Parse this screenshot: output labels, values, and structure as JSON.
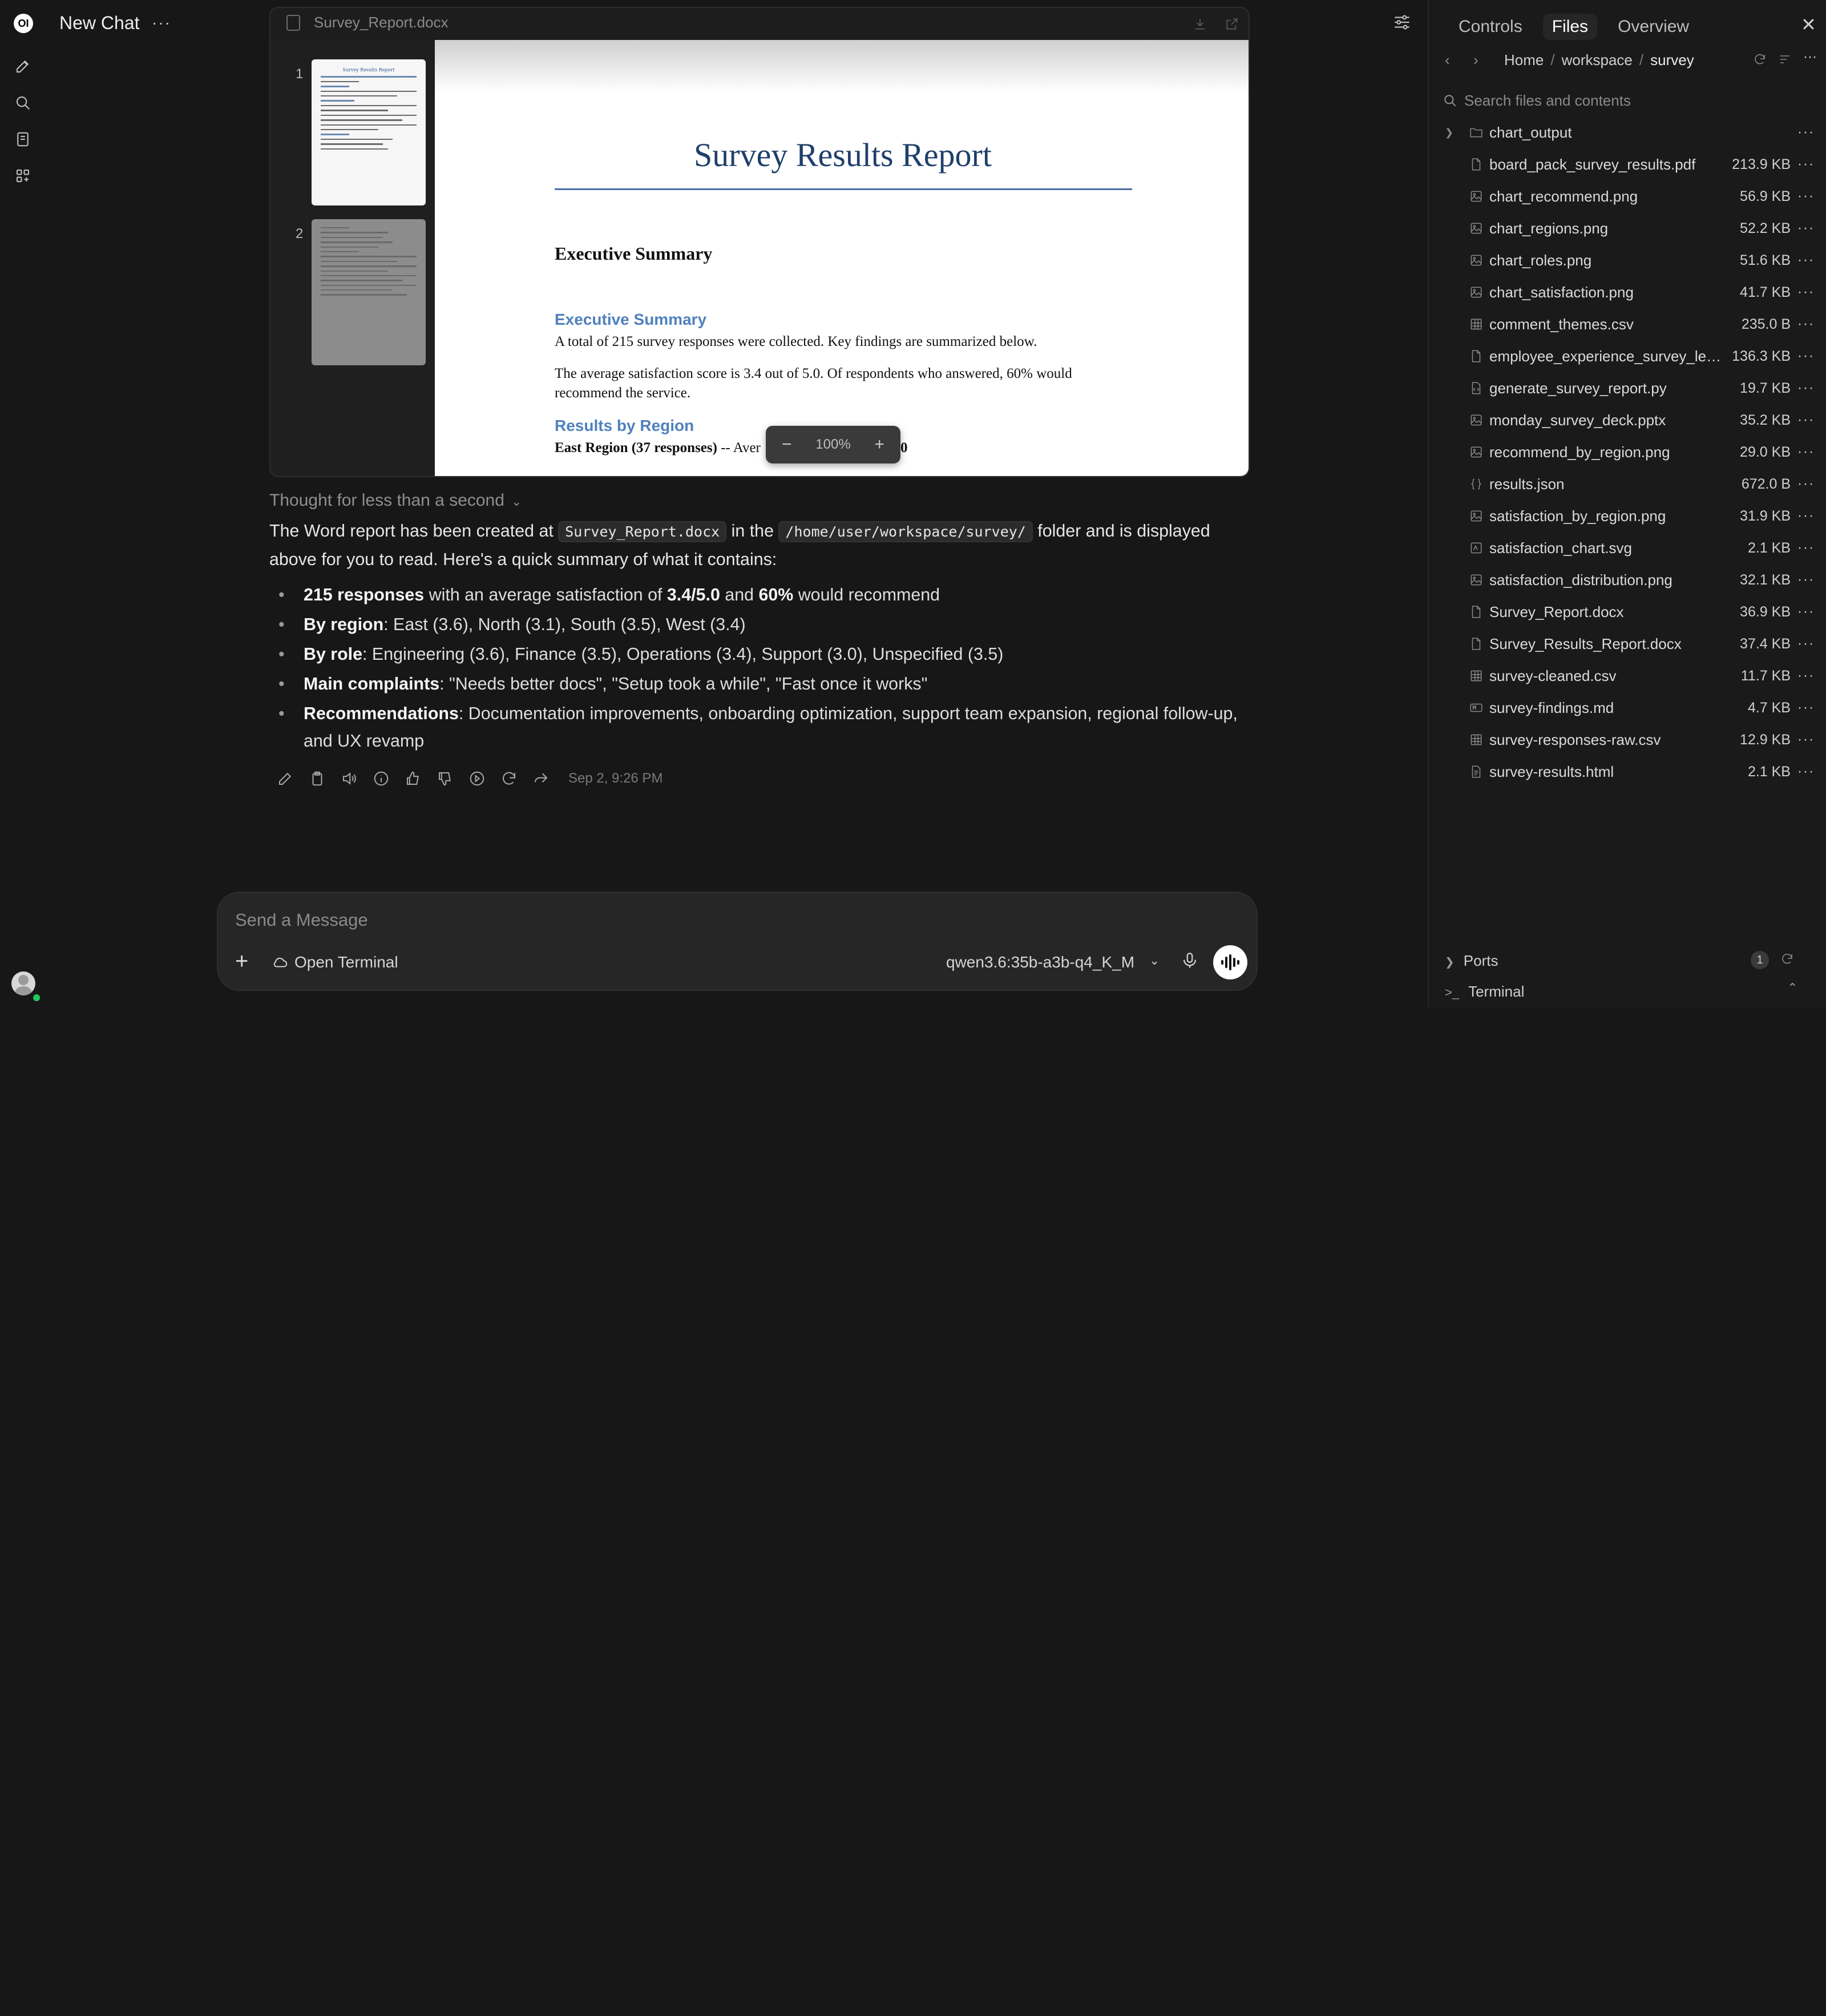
{
  "rail": {
    "logo": "OI"
  },
  "header": {
    "title": "New Chat",
    "more": "···"
  },
  "viewer": {
    "filename": "Survey_Report.docx",
    "thumbs": [
      "1",
      "2"
    ],
    "zoom": "100%",
    "zoom_minus": "−",
    "zoom_plus": "+",
    "doc": {
      "title": "Survey Results Report",
      "h1": "Executive Summary",
      "h2_exec": "Executive Summary",
      "p1": "A total of 215 survey responses were collected. Key findings are summarized below.",
      "p2": "The average satisfaction score is 3.4 out of 5.0. Of respondents who answered, 60% would recommend the service.",
      "h2_region": "Results by Region",
      "p3_bold": "East Region (37 responses)",
      "p3_rest": " -- Aver",
      "p3_tail": "0"
    }
  },
  "message": {
    "thought": "Thought for less than a second",
    "intro_1": "The Word report has been created at ",
    "intro_code1": "Survey_Report.docx",
    "intro_2": " in the ",
    "intro_code2": "/home/user/workspace/survey/",
    "intro_3": " folder and is displayed above for you to read. Here's a quick summary of what it contains:",
    "bullets": [
      {
        "bold": "215 responses",
        "text1": " with an average satisfaction of ",
        "bold2": "3.4/5.0",
        "text2": " and ",
        "bold3": "60%",
        "text3": " would recommend"
      },
      {
        "bold": "By region",
        "text": ": East (3.6), North (3.1), South (3.5), West (3.4)"
      },
      {
        "bold": "By role",
        "text": ": Engineering (3.6), Finance (3.5), Operations (3.4), Support (3.0), Unspecified (3.5)"
      },
      {
        "bold": "Main complaints",
        "text": ": \"Needs better docs\", \"Setup took a while\", \"Fast once it works\""
      },
      {
        "bold": "Recommendations",
        "text": ": Documentation improvements, onboarding optimization, support team expansion, regional follow-up, and UX revamp"
      }
    ],
    "timestamp": "Sep 2, 9:26 PM"
  },
  "composer": {
    "placeholder": "Send a Message",
    "plus": "+",
    "terminal": "Open Terminal",
    "model": "qwen3.6:35b-a3b-q4_K_M"
  },
  "panel": {
    "tabs": [
      "Controls",
      "Files",
      "Overview"
    ],
    "active_tab": "Files",
    "crumbs": [
      "Home",
      "workspace",
      "survey"
    ],
    "search_placeholder": "Search files and contents",
    "files": [
      {
        "name": "chart_output",
        "size": "",
        "icon": "folder-icon"
      },
      {
        "name": "board_pack_survey_results.pdf",
        "size": "213.9 KB",
        "icon": "file-icon"
      },
      {
        "name": "chart_recommend.png",
        "size": "56.9 KB",
        "icon": "image-icon"
      },
      {
        "name": "chart_regions.png",
        "size": "52.2 KB",
        "icon": "image-icon"
      },
      {
        "name": "chart_roles.png",
        "size": "51.6 KB",
        "icon": "image-icon"
      },
      {
        "name": "chart_satisfaction.png",
        "size": "41.7 KB",
        "icon": "image-icon"
      },
      {
        "name": "comment_themes.csv",
        "size": "235.0 B",
        "icon": "table-icon"
      },
      {
        "name": "employee_experience_survey_lead...",
        "size": "136.3 KB",
        "icon": "file-icon"
      },
      {
        "name": "generate_survey_report.py",
        "size": "19.7 KB",
        "icon": "code-icon"
      },
      {
        "name": "monday_survey_deck.pptx",
        "size": "35.2 KB",
        "icon": "image-icon"
      },
      {
        "name": "recommend_by_region.png",
        "size": "29.0 KB",
        "icon": "image-icon"
      },
      {
        "name": "results.json",
        "size": "672.0 B",
        "icon": "json-icon"
      },
      {
        "name": "satisfaction_by_region.png",
        "size": "31.9 KB",
        "icon": "image-icon"
      },
      {
        "name": "satisfaction_chart.svg",
        "size": "2.1 KB",
        "icon": "svg-icon"
      },
      {
        "name": "satisfaction_distribution.png",
        "size": "32.1 KB",
        "icon": "image-icon"
      },
      {
        "name": "Survey_Report.docx",
        "size": "36.9 KB",
        "icon": "file-icon"
      },
      {
        "name": "Survey_Results_Report.docx",
        "size": "37.4 KB",
        "icon": "file-icon"
      },
      {
        "name": "survey-cleaned.csv",
        "size": "11.7 KB",
        "icon": "table-icon"
      },
      {
        "name": "survey-findings.md",
        "size": "4.7 KB",
        "icon": "markdown-icon"
      },
      {
        "name": "survey-responses-raw.csv",
        "size": "12.9 KB",
        "icon": "table-icon"
      },
      {
        "name": "survey-results.html",
        "size": "2.1 KB",
        "icon": "html-icon"
      }
    ],
    "ports": "Ports",
    "ports_count": "1",
    "terminal": "Terminal"
  },
  "colors": {
    "background": "#171717",
    "panel": "#1a1a1a",
    "doc_title": "#1f3f6b",
    "doc_heading": "#4f81bd",
    "online": "#22c55e"
  }
}
